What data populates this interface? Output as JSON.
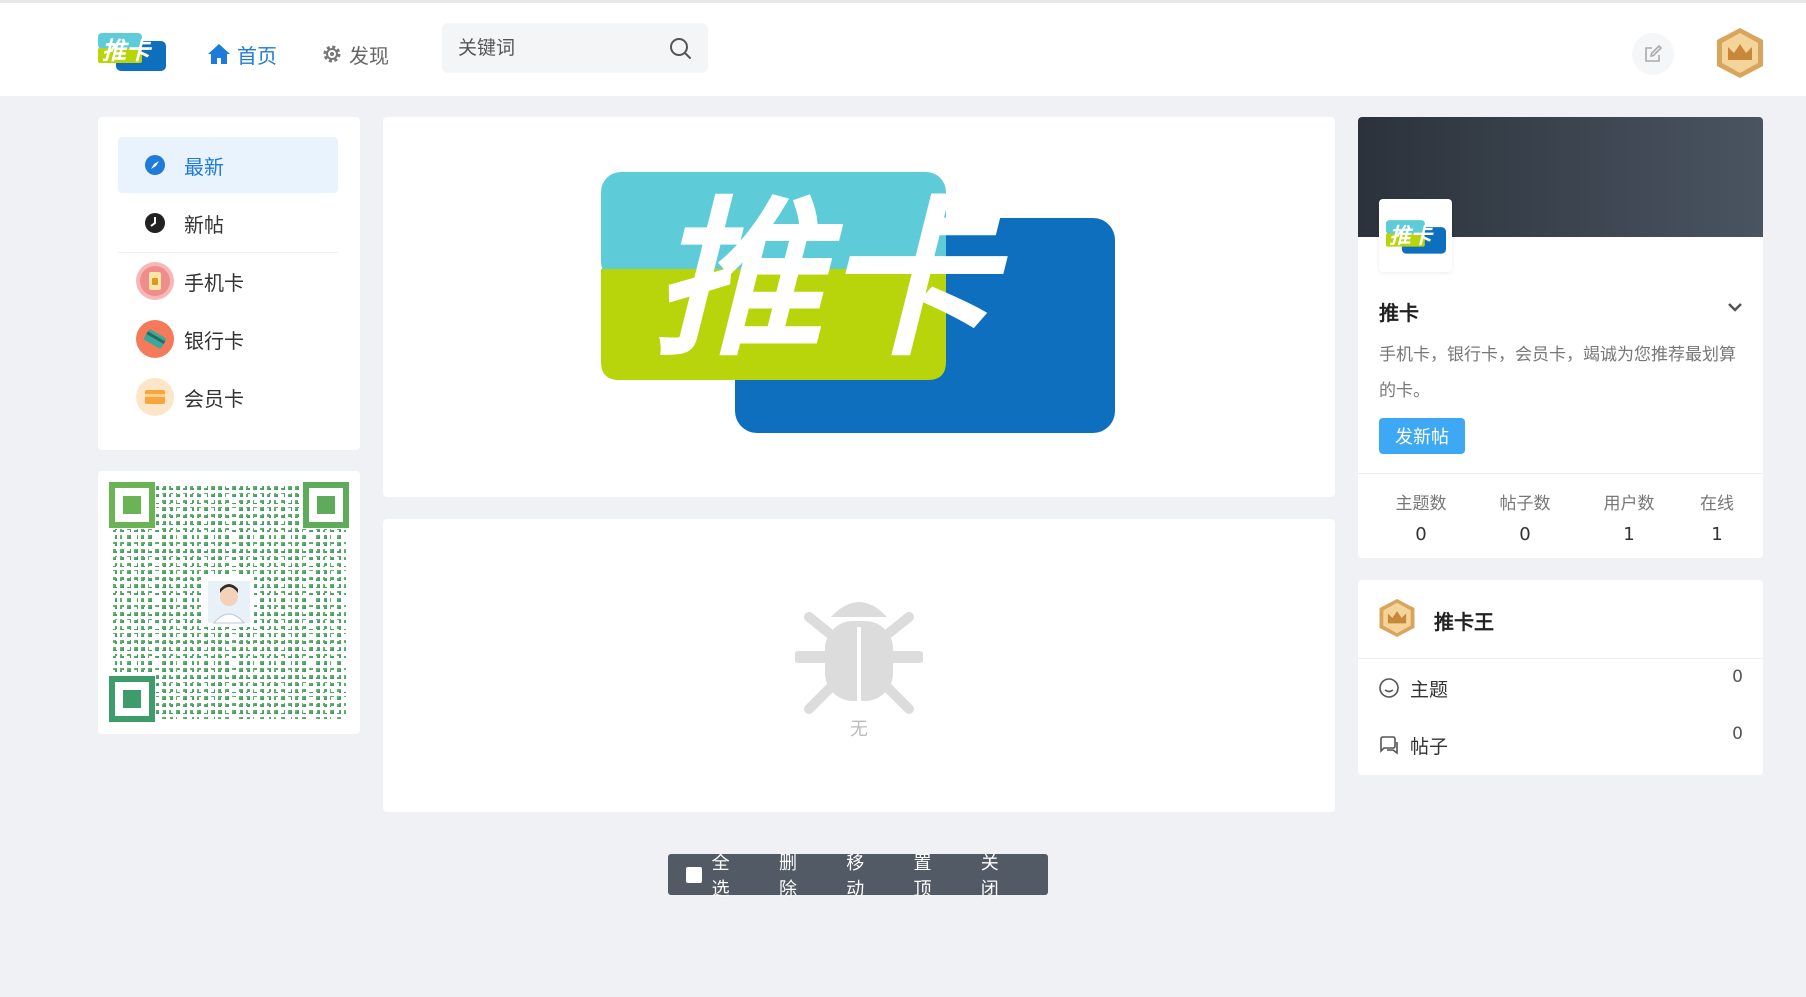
{
  "header": {
    "logo_text": "推卡",
    "nav": [
      {
        "label": "首页",
        "icon": "home-icon",
        "active": true
      },
      {
        "label": "发现",
        "icon": "gear-icon",
        "active": false
      }
    ],
    "search_placeholder": "关键词"
  },
  "sidebar": {
    "items": [
      {
        "label": "最新",
        "icon": "compass-icon",
        "active": true
      },
      {
        "label": "新帖",
        "icon": "clock-icon",
        "active": false
      },
      {
        "label": "手机卡",
        "icon": "sim-card-icon",
        "active": false
      },
      {
        "label": "银行卡",
        "icon": "bank-card-icon",
        "active": false
      },
      {
        "label": "会员卡",
        "icon": "member-card-icon",
        "active": false
      }
    ]
  },
  "banner": {
    "logo_text": "推卡"
  },
  "empty": {
    "text": "无"
  },
  "toolbar": {
    "select_all": "全选",
    "delete": "删除",
    "move": "移动",
    "pin": "置顶",
    "close": "关闭"
  },
  "forum": {
    "name": "推卡",
    "description": "手机卡，银行卡，会员卡，竭诚为您推荐最划算的卡。",
    "post_button": "发新帖",
    "stats": [
      {
        "label": "主题数",
        "value": "0"
      },
      {
        "label": "帖子数",
        "value": "0"
      },
      {
        "label": "用户数",
        "value": "1"
      },
      {
        "label": "在线",
        "value": "1"
      }
    ]
  },
  "user": {
    "name": "推卡王",
    "rows": [
      {
        "label": "主题",
        "count": "0"
      },
      {
        "label": "帖子",
        "count": "0"
      }
    ]
  },
  "colors": {
    "accent": "#1e7bd9",
    "button": "#3ea8f5",
    "logo_teal": "#5ecbd9",
    "logo_lime": "#b8d40a",
    "logo_blue": "#0d6fbd"
  }
}
